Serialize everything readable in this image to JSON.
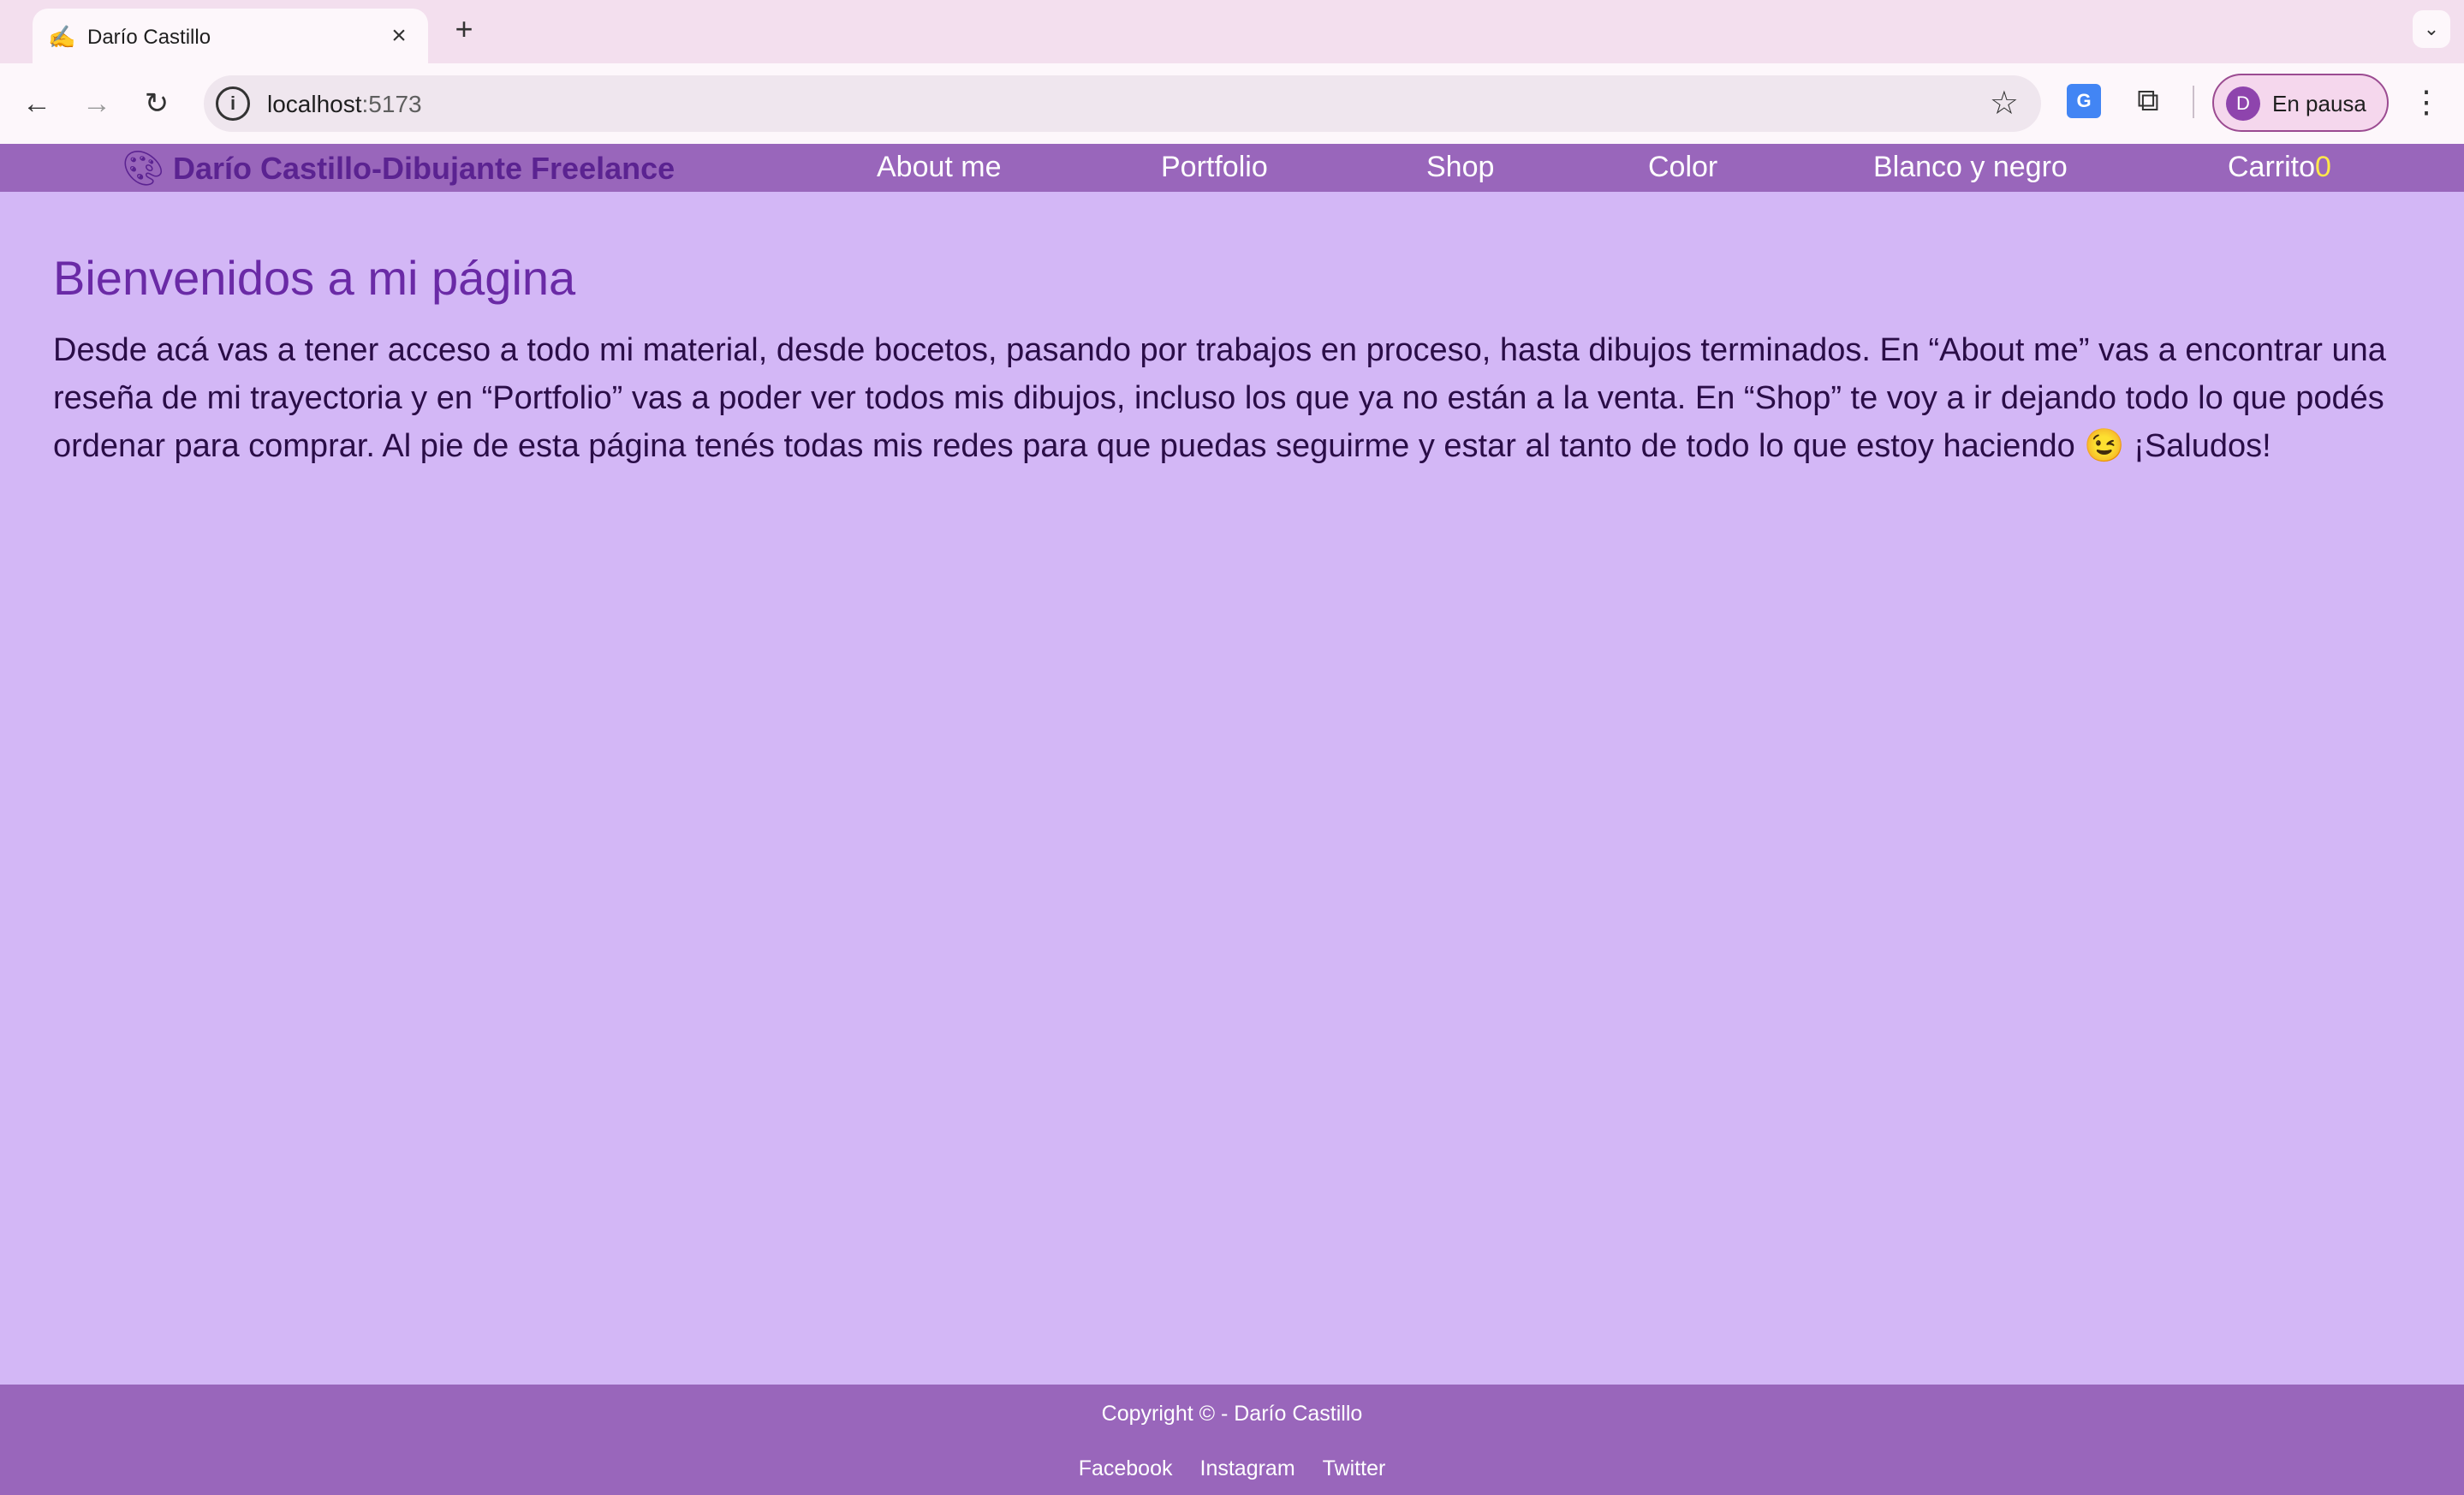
{
  "browser": {
    "tab_title": "Darío Castillo",
    "url_host": "localhost",
    "url_port": ":5173",
    "profile_initial": "D",
    "profile_label": "En pausa"
  },
  "site": {
    "brand": "Darío Castillo-Dibujante Freelance",
    "nav": {
      "about": "About me",
      "portfolio": "Portfolio",
      "shop": "Shop",
      "color": "Color",
      "bw": "Blanco y negro",
      "cart_label": "Carrito",
      "cart_count": "0"
    }
  },
  "main": {
    "heading": "Bienvenidos a mi página",
    "intro": "Desde acá vas a tener acceso a todo mi material, desde bocetos, pasando por trabajos en proceso, hasta dibujos terminados. En “About me” vas a encontrar una reseña de mi trayectoria y en “Portfolio” vas a poder ver todos mis dibujos, incluso los que ya no están a la venta. En “Shop” te voy a ir dejando todo lo que podés ordenar para comprar. Al pie de esta página tenés todas mis redes para que puedas seguirme y estar al tanto de todo lo que estoy haciendo 😉 ¡Saludos!"
  },
  "footer": {
    "copyright": "Copyright © - Darío Castillo",
    "social": [
      "Facebook",
      "Instagram",
      "Twitter"
    ]
  },
  "colors": {
    "page_bg": "#d3b7f6",
    "nav_bg": "#9966bb",
    "brand": "#5b2391",
    "heading": "#6a2aa6",
    "cart_count": "#ffe84a"
  },
  "icons": {
    "tab_favicon": "paintbrush-icon",
    "brand_icon": "palette-icon"
  }
}
